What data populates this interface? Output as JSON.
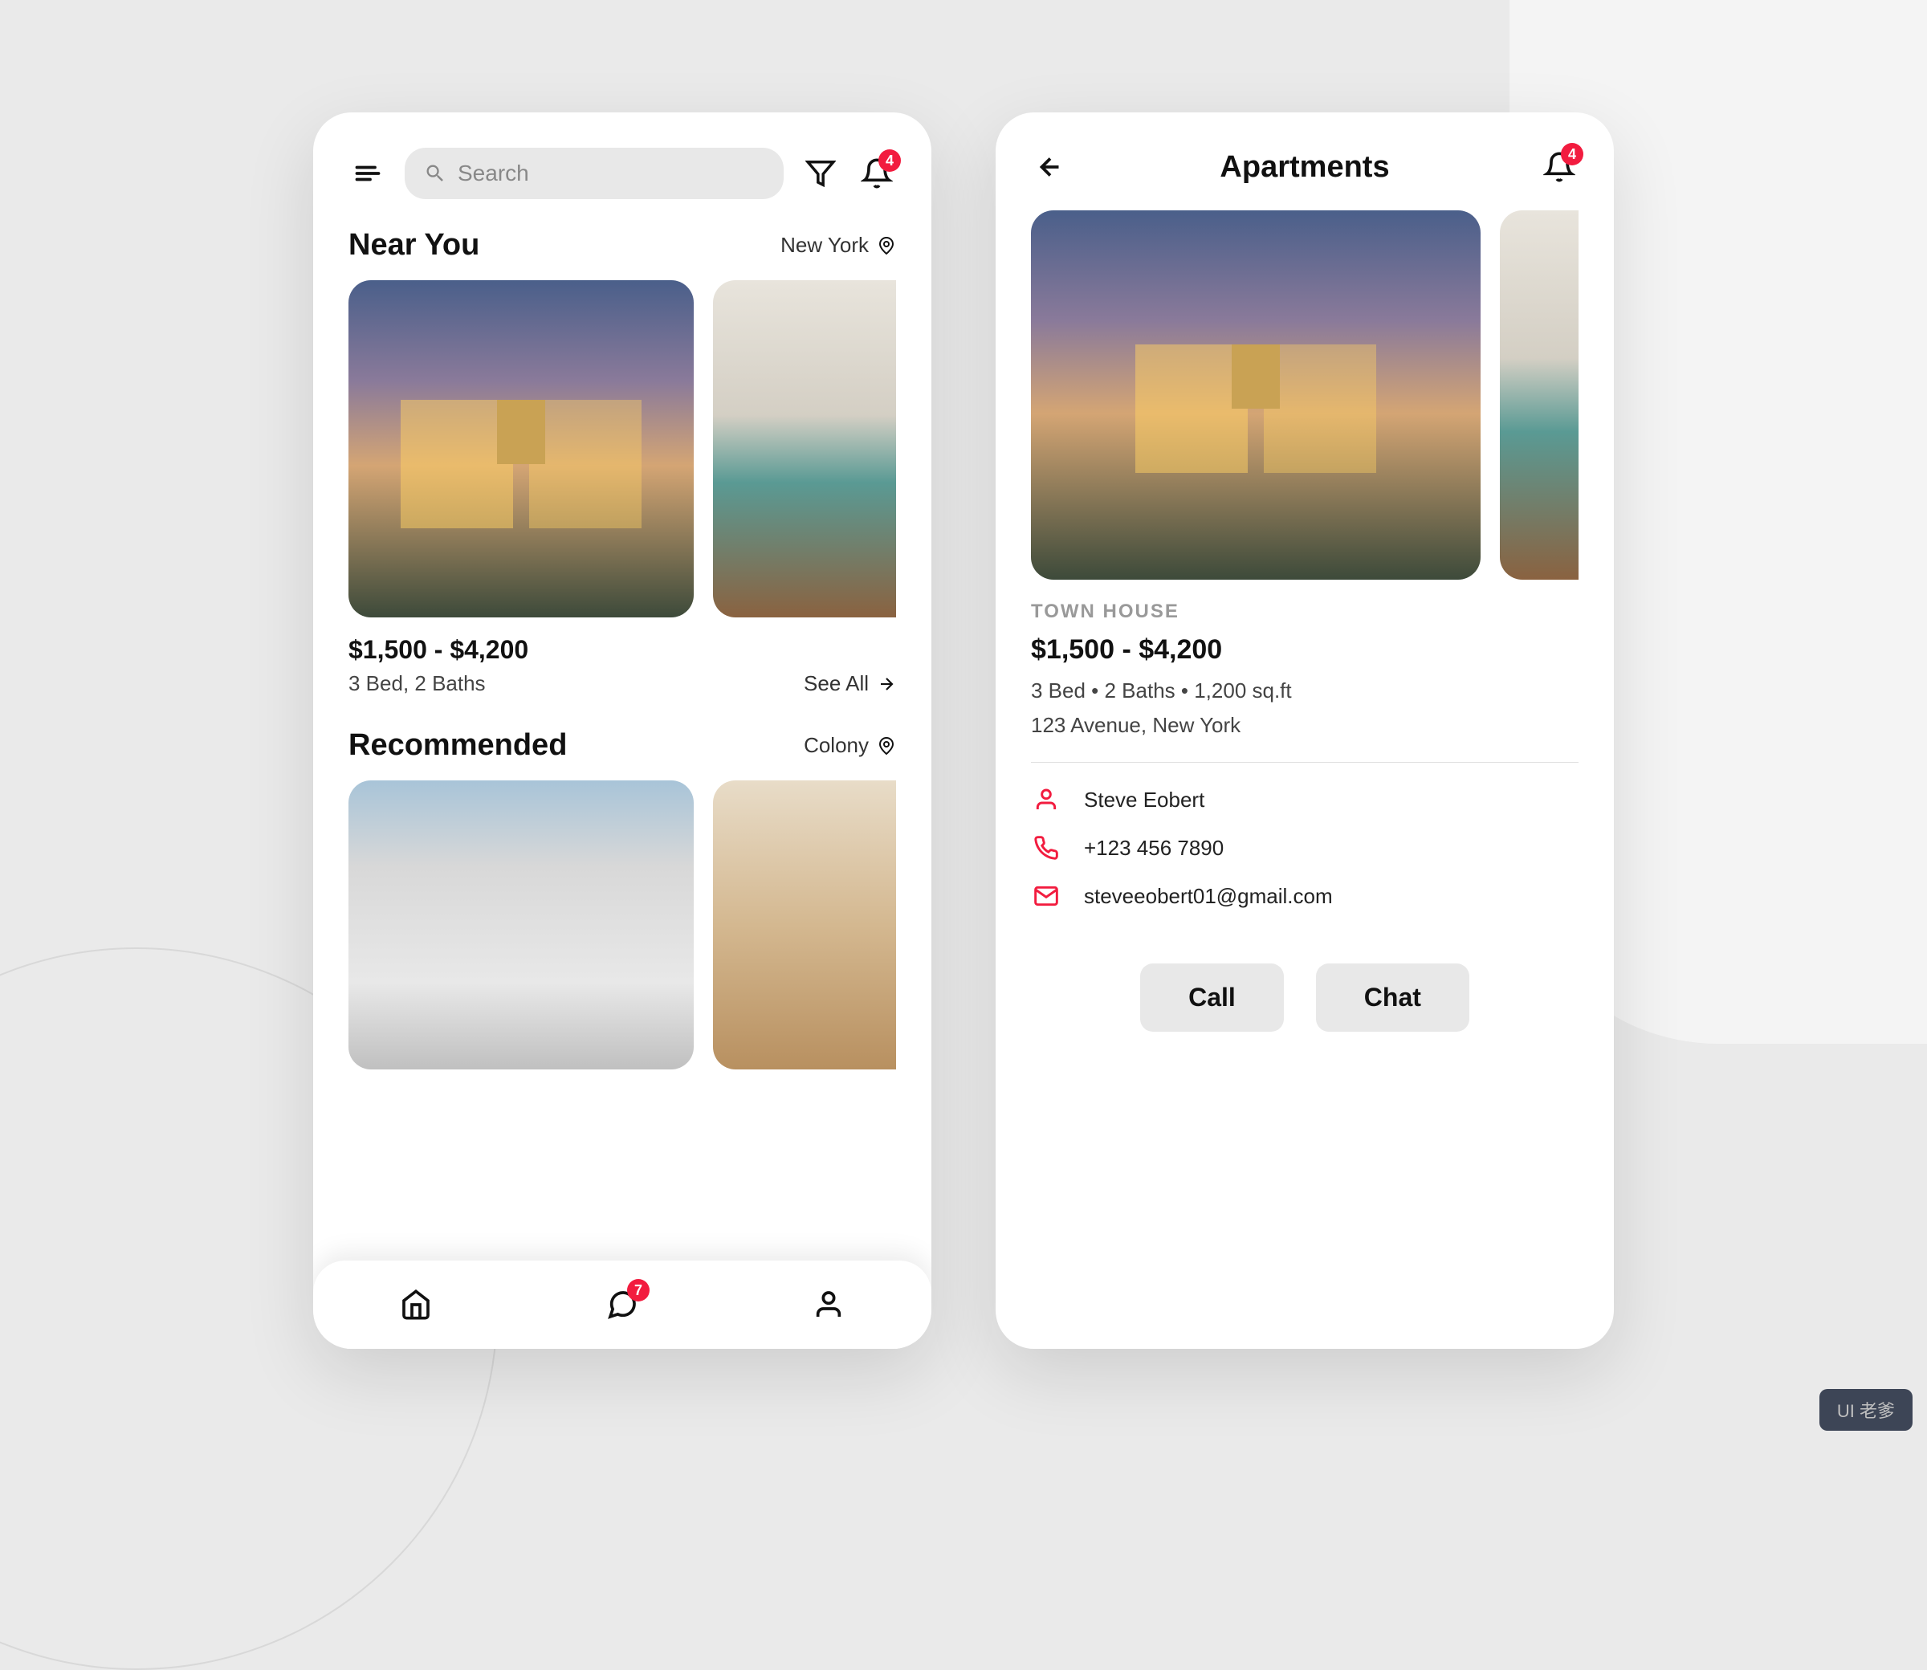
{
  "screen1": {
    "search_placeholder": "Search",
    "notif_badge": "4",
    "near": {
      "title": "Near You",
      "location": "New York",
      "price": "$1,500 - $4,200",
      "details": "3 Bed, 2 Baths",
      "see_all": "See All"
    },
    "recommended": {
      "title": "Recommended",
      "location": "Colony"
    },
    "nav_chat_badge": "7"
  },
  "screen2": {
    "title": "Apartments",
    "notif_badge": "4",
    "category": "TOWN HOUSE",
    "price": "$1,500 - $4,200",
    "specs": "3 Bed  •  2 Baths  •  1,200 sq.ft",
    "address": "123 Avenue, New York",
    "contact": {
      "name": "Steve Eobert",
      "phone": "+123 456 7890",
      "email": "steveeobert01@gmail.com"
    },
    "actions": {
      "call": "Call",
      "chat": "Chat"
    }
  },
  "watermark": "UI 老爹"
}
